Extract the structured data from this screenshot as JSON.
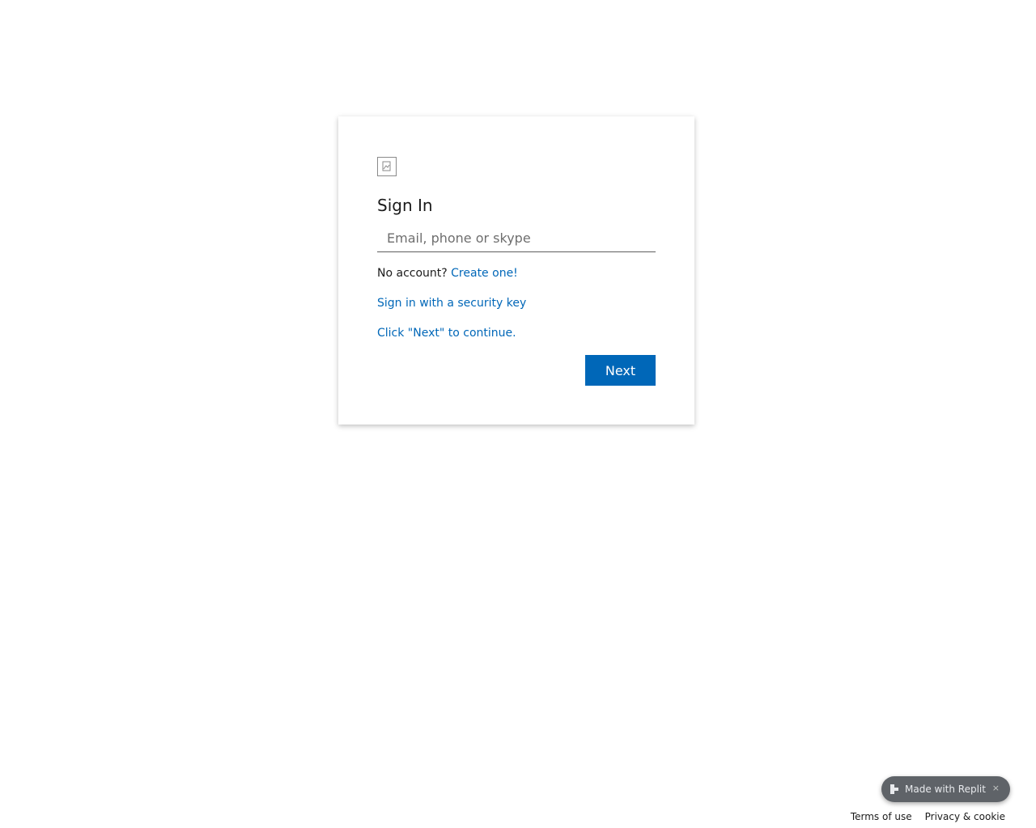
{
  "signin": {
    "title": "Sign In",
    "email_placeholder": "Email, phone or skype",
    "email_value": "",
    "no_account_text": "No account?",
    "create_link": "Create one!",
    "security_key_link": "Sign in with a security key",
    "continue_hint": "Click \"Next\" to continue.",
    "next_button": "Next"
  },
  "badge": {
    "label": "Made with Replit",
    "close": "×",
    "icon": "replit-logo-icon"
  },
  "footer": {
    "terms": "Terms of use",
    "privacy": "Privacy & cookie"
  },
  "colors": {
    "accent": "#0067b8",
    "badge_bg": "#5f6368"
  }
}
